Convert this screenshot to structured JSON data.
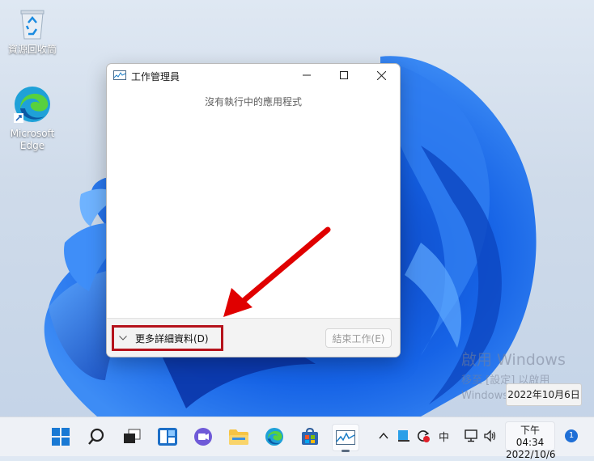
{
  "desktop": {
    "icons": [
      {
        "label": "資源回收筒",
        "icon": "recycle-bin-icon"
      },
      {
        "label": "Microsoft Edge",
        "icon": "edge-icon"
      }
    ],
    "watermark": {
      "line1": "啟用 Windows",
      "line2": "移至 [設定] 以啟用",
      "line3": "Windows。"
    },
    "tooltip": "2022年10月6日"
  },
  "window": {
    "title": "工作管理員",
    "empty_message": "沒有執行中的應用程式",
    "more_details_label": "更多詳細資料(D)",
    "end_task_label": "結束工作(E)",
    "controls": [
      "minimize-icon",
      "maximize-icon",
      "close-icon"
    ]
  },
  "annotation": {
    "arrow_color": "#e00000",
    "highlight_color": "#b5121b"
  },
  "taskbar": {
    "pinned": [
      "start-icon",
      "search-icon",
      "task-view-icon",
      "widgets-icon",
      "chat-icon",
      "file-explorer-icon",
      "edge-icon",
      "store-icon",
      "task-manager-icon"
    ],
    "tray": {
      "ime_label": "中"
    },
    "clock": {
      "time": "下午 04:34",
      "date": "2022/10/6"
    },
    "notification_count": "1"
  }
}
